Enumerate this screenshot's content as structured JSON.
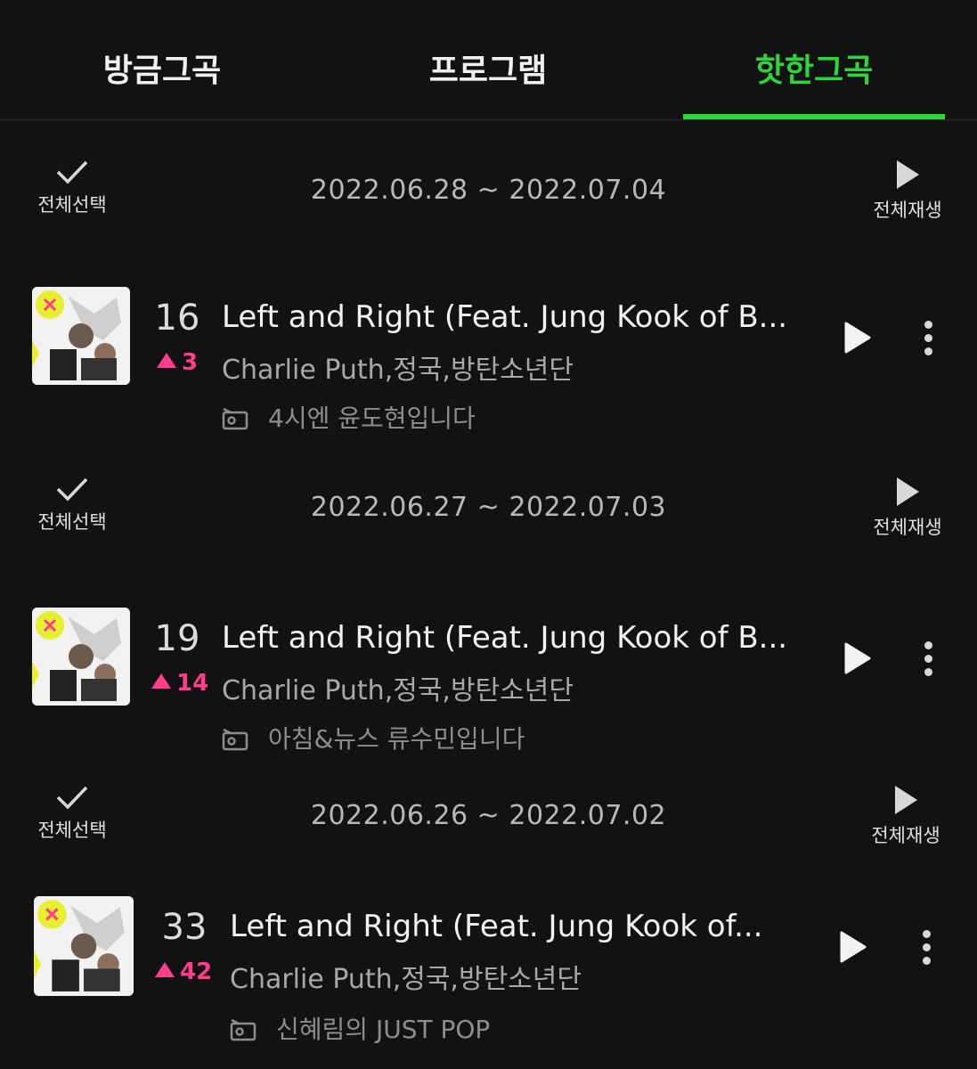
{
  "tabs": [
    {
      "label": "방금그곡"
    },
    {
      "label": "프로그램"
    },
    {
      "label": "핫한그곡"
    }
  ],
  "active_tab": 2,
  "common": {
    "select_all_label": "전체선택",
    "play_all_label": "전체재생"
  },
  "sections": [
    {
      "date_range": "2022.06.28 ~ 2022.07.04",
      "song": {
        "rank": "16",
        "change": "3",
        "title": "Left and Right (Feat. Jung Kook of B...",
        "artist": "Charlie Puth,정국,방탄소년단",
        "program": "4시엔 윤도현입니다"
      }
    },
    {
      "date_range": "2022.06.27 ~ 2022.07.03",
      "song": {
        "rank": "19",
        "change": "14",
        "title": "Left and Right (Feat. Jung Kook of B...",
        "artist": "Charlie Puth,정국,방탄소년단",
        "program": "아침&뉴스 류수민입니다"
      }
    },
    {
      "date_range": "2022.06.26 ~ 2022.07.02",
      "song": {
        "rank": "33",
        "change": "42",
        "title": "Left and Right (Feat. Jung Kook of...",
        "artist": "Charlie Puth,정국,방탄소년단",
        "program": "신혜림의 JUST POP"
      }
    }
  ],
  "colors": {
    "accent": "#2fd33b",
    "rank_up": "#ff3d8a",
    "background": "#121212"
  },
  "icons": {
    "check": "check-icon",
    "play": "play-icon",
    "more": "more-vertical-icon",
    "radio": "radio-icon"
  }
}
